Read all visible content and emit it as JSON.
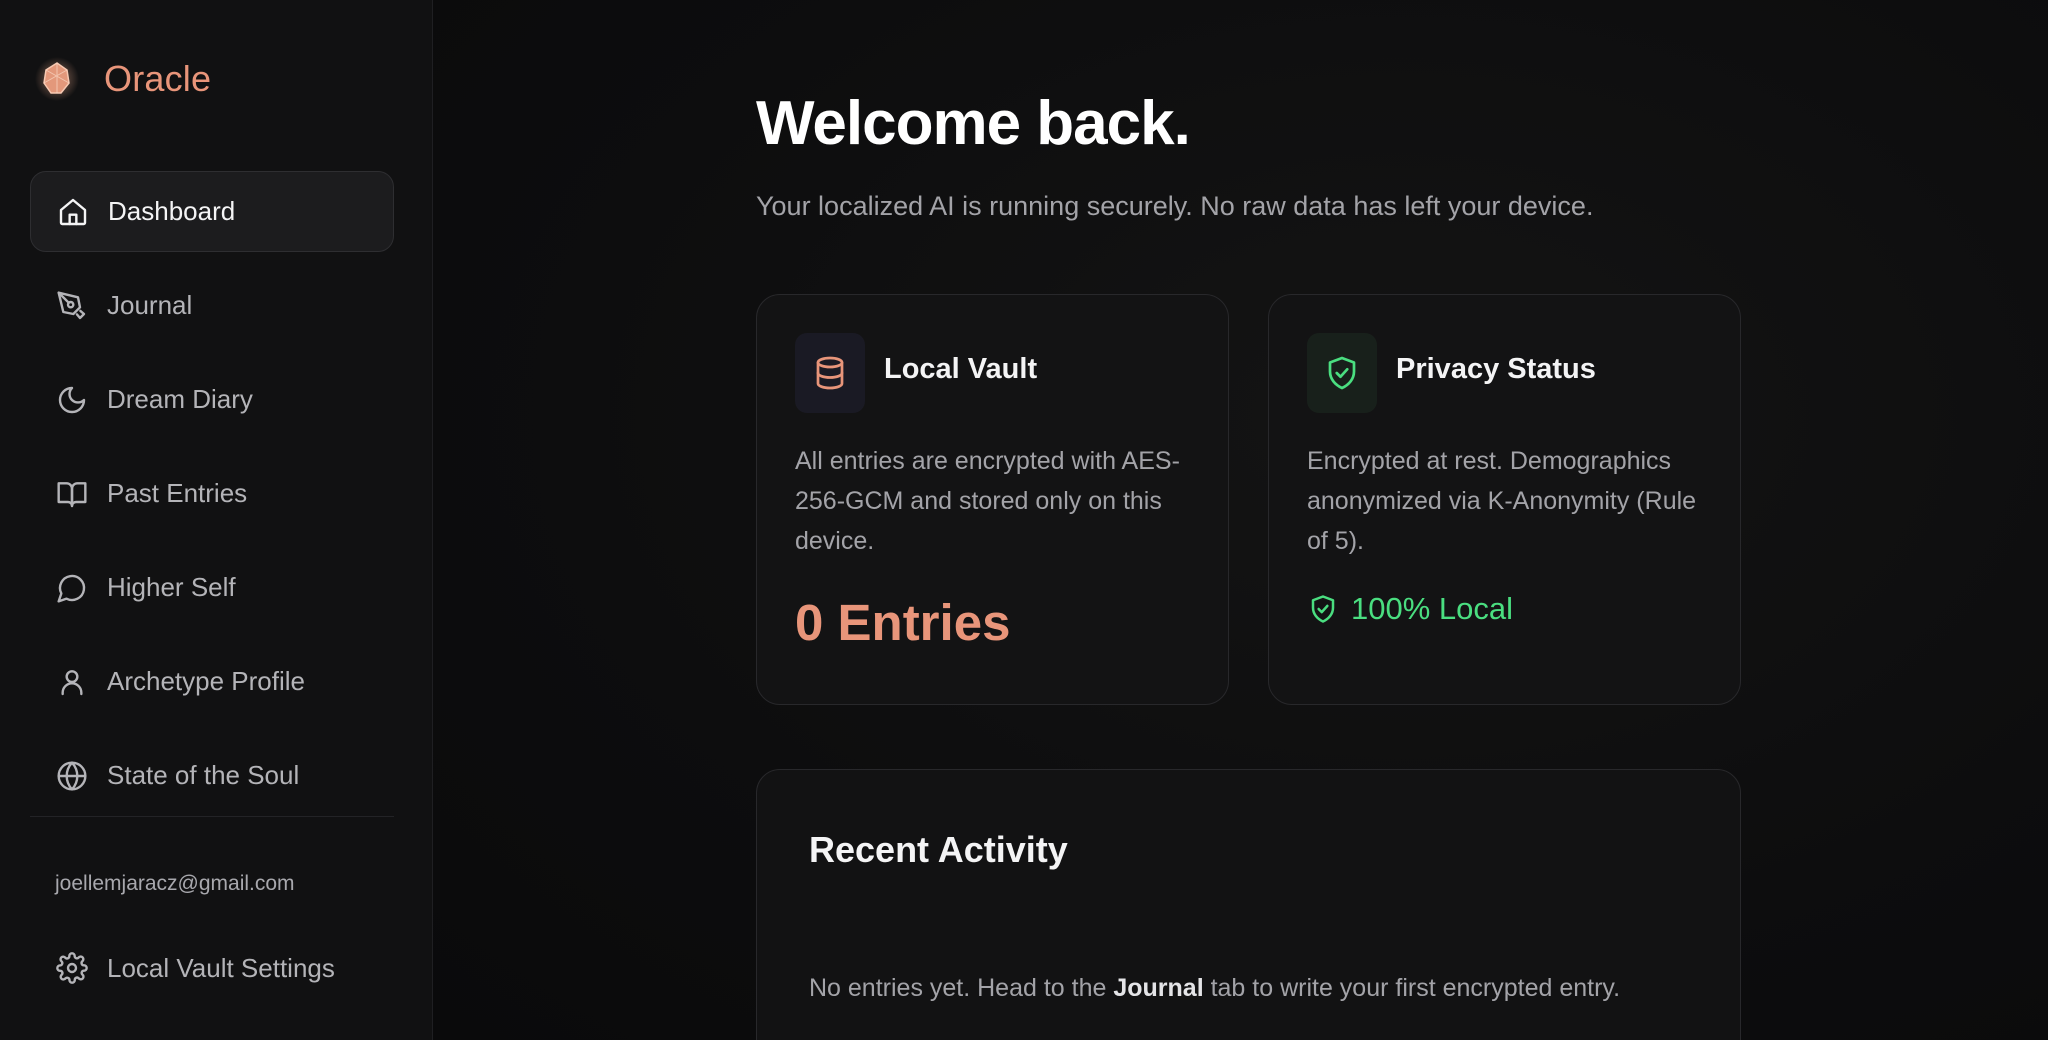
{
  "brand": {
    "name": "Oracle"
  },
  "nav": {
    "items": [
      {
        "label": "Dashboard",
        "icon": "home-icon",
        "active": true
      },
      {
        "label": "Journal",
        "icon": "pen-nib-icon",
        "active": false
      },
      {
        "label": "Dream Diary",
        "icon": "moon-icon",
        "active": false
      },
      {
        "label": "Past Entries",
        "icon": "book-open-icon",
        "active": false
      },
      {
        "label": "Higher Self",
        "icon": "chat-bubble-icon",
        "active": false
      },
      {
        "label": "Archetype Profile",
        "icon": "user-icon",
        "active": false
      },
      {
        "label": "State of the Soul",
        "icon": "globe-icon",
        "active": false
      }
    ]
  },
  "user": {
    "email": "joellemjaracz@gmail.com"
  },
  "settings": {
    "label": "Local Vault Settings",
    "icon": "gear-icon"
  },
  "header": {
    "title": "Welcome back.",
    "subtitle": "Your localized AI is running securely. No raw data has left your device."
  },
  "vault_card": {
    "icon": "database-icon",
    "title": "Local Vault",
    "description": "All entries are encrypted with AES-256-GCM and stored only on this device.",
    "count": "0 Entries"
  },
  "privacy_card": {
    "icon": "shield-check-icon",
    "title": "Privacy Status",
    "description": "Encrypted at rest. Demographics anonymized via K-Anonymity (Rule of 5).",
    "status": "100% Local"
  },
  "activity": {
    "title": "Recent Activity",
    "empty_prefix": "No entries yet. Head to the ",
    "empty_link": "Journal",
    "empty_suffix": " tab to write your first encrypted entry."
  },
  "colors": {
    "accent": "#e8957a",
    "success": "#4ade80",
    "background": "#0c0c0d",
    "sidebar": "#111112"
  }
}
